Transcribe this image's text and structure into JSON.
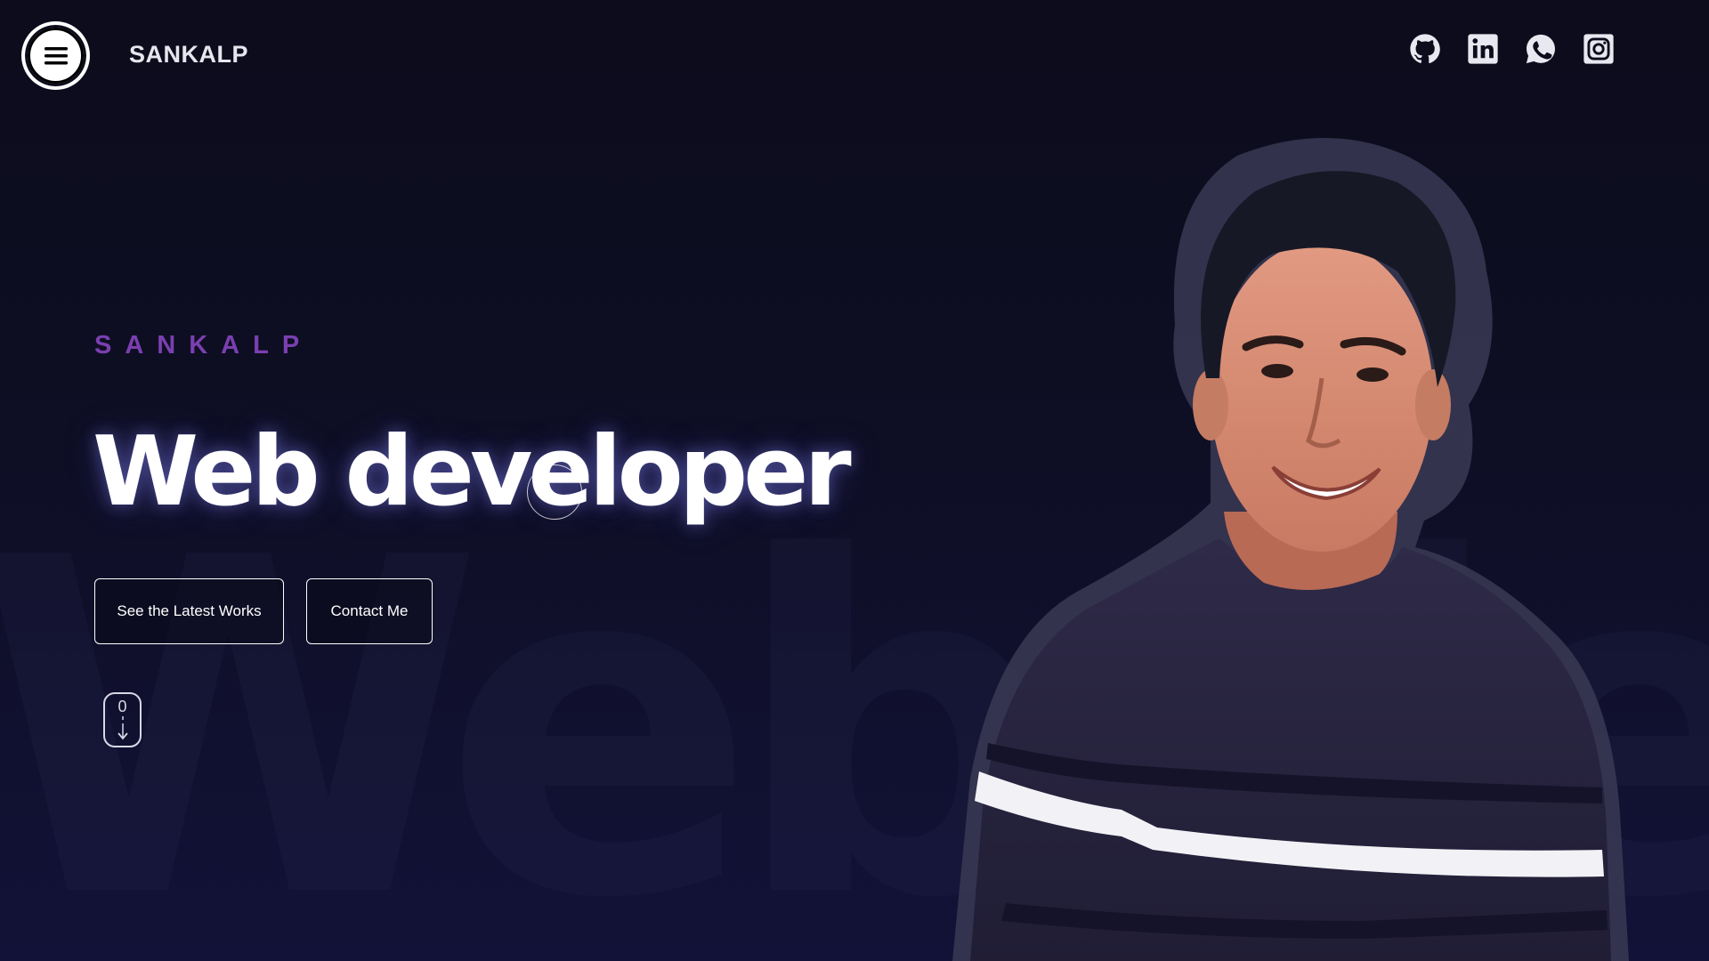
{
  "header": {
    "logo": "SANKALP",
    "socials": [
      "github-icon",
      "linkedin-icon",
      "whatsapp-icon",
      "instagram-icon"
    ]
  },
  "hero": {
    "eyebrow": "SANKALP",
    "headline": "Web developer",
    "background_word": "Web dev",
    "buttons": {
      "works": "See the Latest Works",
      "contact": "Contact Me"
    },
    "scroll_indicator": "0"
  },
  "colors": {
    "background": "#0c0c1c",
    "accent": "#7a3fb0",
    "text": "#ffffff"
  }
}
